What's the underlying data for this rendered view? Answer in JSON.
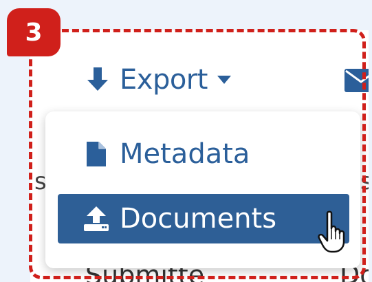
{
  "callout": {
    "step_number": "3",
    "color": "#d0201b"
  },
  "toolbar": {
    "export_label": "Export",
    "export_icon": "arrow-down-icon",
    "caret_icon": "caret-down-icon",
    "mail_icon": "envelope-icon"
  },
  "dropdown": {
    "items": [
      {
        "label": "Metadata",
        "icon": "file-icon",
        "highlighted": false
      },
      {
        "label": "Documents",
        "icon": "upload-icon",
        "highlighted": true
      }
    ]
  },
  "background": {
    "left_fragment": "s",
    "right_fragment": "s",
    "bottom_left_fragment": "Submitte",
    "bottom_right_fragment": "Do"
  },
  "colors": {
    "accent": "#2b5f9a",
    "highlight": "#2e5f96",
    "page_bg": "#edf3fb"
  }
}
